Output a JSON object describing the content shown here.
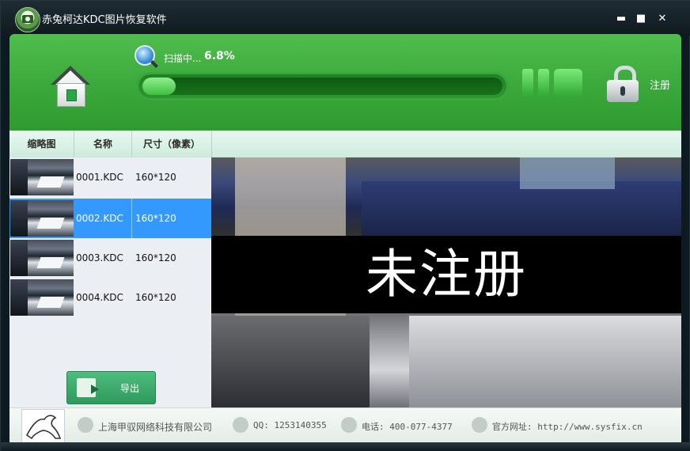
{
  "window": {
    "title": "赤兔柯达KDC图片恢复软件",
    "controls": {
      "minimize": "▬",
      "maximize": "■",
      "close": "✕"
    }
  },
  "header": {
    "scan_status": "扫描中...",
    "scan_percent": "6.8%",
    "progress_fraction": 0.068,
    "register_label": "注册"
  },
  "table": {
    "columns": [
      "缩略图",
      "名称",
      "尺寸（像素）"
    ],
    "rows": [
      {
        "name": "0001.KDC",
        "size": "160*120",
        "selected": false
      },
      {
        "name": "0002.KDC",
        "size": "160*120",
        "selected": true
      },
      {
        "name": "0003.KDC",
        "size": "160*120",
        "selected": false
      },
      {
        "name": "0004.KDC",
        "size": "160*120",
        "selected": false
      }
    ]
  },
  "export_button": {
    "label": "导出"
  },
  "preview": {
    "overlay_text": "未注册"
  },
  "footer": {
    "company": "上海甲驭网络科技有限公司",
    "qq": "QQ: 1253140355",
    "phone": "电话: 400-077-4377",
    "website": "官方网址: http://www.sysfix.cn"
  },
  "icons": [
    "app-logo-icon",
    "home-icon",
    "search-icon",
    "pause-icon",
    "stop-icon",
    "lock-icon",
    "export-icon",
    "company-icon",
    "qq-icon",
    "phone-icon",
    "globe-icon"
  ],
  "colors": {
    "accent_green": "#3aa83b",
    "selection_blue": "#3399ff"
  }
}
